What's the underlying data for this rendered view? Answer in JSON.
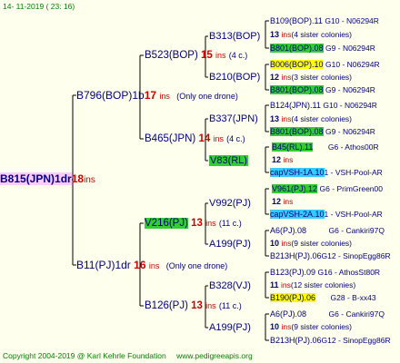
{
  "header": {
    "timestamp": "14- 11-2019 ( 23: 16)"
  },
  "footer": {
    "copyright": "Copyright 2004-2019 @ Karl Kehrle Foundation",
    "site": "www.pedigreeapis.org"
  },
  "colors": {
    "background": "#ffffee",
    "root_highlight": "#ffccff",
    "green_highlight": "#33cc33",
    "yellow_highlight": "#ffff00",
    "cyan_highlight": "#33ccff",
    "inbreeding_text": "#cc0000",
    "name_text": "#000080"
  },
  "root": {
    "name": "B815(JPN)1dr",
    "ins_num": "18",
    "ins_label": "ins"
  },
  "nodes": {
    "b796": {
      "name": "B796(BOP)1b",
      "ins_num": "17",
      "ins_label": "ins",
      "note": "(Only one drone)"
    },
    "b11": {
      "name": "B11(PJ)1dr",
      "ins_num": "16",
      "ins_label": "ins",
      "note": "(Only one drone)"
    },
    "b523": {
      "name": "B523(BOP)",
      "ins_num": "15",
      "ins_label": "ins",
      "note": "(4 c.)"
    },
    "b465": {
      "name": "B465(JPN)",
      "ins_num": "14",
      "ins_label": "ins",
      "note": "(4 c.)"
    },
    "v216": {
      "name": "V216(PJ)",
      "ins_num": "13",
      "ins_label": "ins",
      "note": "(11 c.)"
    },
    "b126": {
      "name": "B126(PJ)",
      "ins_num": "13",
      "ins_label": "ins",
      "note": "(11 c.)"
    },
    "b313": {
      "name": "B313(BOP)"
    },
    "b210": {
      "name": "B210(BOP)"
    },
    "b337": {
      "name": "B337(JPN)"
    },
    "v83": {
      "name": "V83(RL)"
    },
    "v992": {
      "name": "V992(PJ)"
    },
    "a199a": {
      "name": "A199(PJ)"
    },
    "b328": {
      "name": "B328(VJ)"
    },
    "a199b": {
      "name": "A199(PJ)"
    }
  },
  "leaves": [
    {
      "id": "l1",
      "name": "B109(BOP).11",
      "code": "G10 - N06294R",
      "hl": ""
    },
    {
      "id": "l2",
      "num": "13",
      "ins": "ins",
      "note": "(4 sister colonies)"
    },
    {
      "id": "l3",
      "name": "B801(BOP).08",
      "code": "G9 - N06294R",
      "hl": "green"
    },
    {
      "id": "l4",
      "name": "B006(BOP).10",
      "code": "G10 - N06294R",
      "hl": "yellow"
    },
    {
      "id": "l5",
      "num": "12",
      "ins": "ins",
      "note": "(3 sister colonies)"
    },
    {
      "id": "l6",
      "name": "B801(BOP).08",
      "code": "G9 - N06294R",
      "hl": "green"
    },
    {
      "id": "l7",
      "name": "B124(JPN).11",
      "code": "G10 - N06294R",
      "hl": ""
    },
    {
      "id": "l8",
      "num": "13",
      "ins": "ins",
      "note": "(4 sister colonies)"
    },
    {
      "id": "l9",
      "name": "B801(BOP).08",
      "code": "G9 - N06294R",
      "hl": "green"
    },
    {
      "id": "l10",
      "name": "B45(RL).11",
      "code": "G6 - Athos00R",
      "hl": "green"
    },
    {
      "id": "l11",
      "num": "12",
      "ins": "ins",
      "note": ""
    },
    {
      "id": "l12",
      "name": "capVSH-1A.10",
      "code": "1 - VSH-Pool-AR",
      "hl": "cyan"
    },
    {
      "id": "l13",
      "name": "V961(PJ).12",
      "code": "G6 - PrimGreen00",
      "hl": "green"
    },
    {
      "id": "l14",
      "num": "12",
      "ins": "ins",
      "note": ""
    },
    {
      "id": "l15",
      "name": "capVSH-2A.10",
      "code": "1 - VSH-Pool-AR",
      "hl": "cyan"
    },
    {
      "id": "l16",
      "name": "A6(PJ).08",
      "code": "G6 - Cankiri97Q",
      "hl": ""
    },
    {
      "id": "l17",
      "num": "10",
      "ins": "ins",
      "note": "(9 sister colonies)"
    },
    {
      "id": "l18",
      "name": "B213H(PJ).06",
      "code": "G12 - SinopEgg86R",
      "hl": ""
    },
    {
      "id": "l19",
      "name": "B123(PJ).09",
      "code": "G16 - AthosSt80R",
      "hl": ""
    },
    {
      "id": "l20",
      "num": "11",
      "ins": "ins",
      "note": "(12 sister colonies)"
    },
    {
      "id": "l21",
      "name": "B190(PJ).06",
      "code": "G28 - B-xx43",
      "hl": "yellow"
    },
    {
      "id": "l22",
      "name": "A6(PJ).08",
      "code": "G6 - Cankiri97Q",
      "hl": ""
    },
    {
      "id": "l23",
      "num": "10",
      "ins": "ins",
      "note": "(9 sister colonies)"
    },
    {
      "id": "l24",
      "name": "B213H(PJ).06",
      "code": "G12 - SinopEgg86R",
      "hl": ""
    }
  ]
}
